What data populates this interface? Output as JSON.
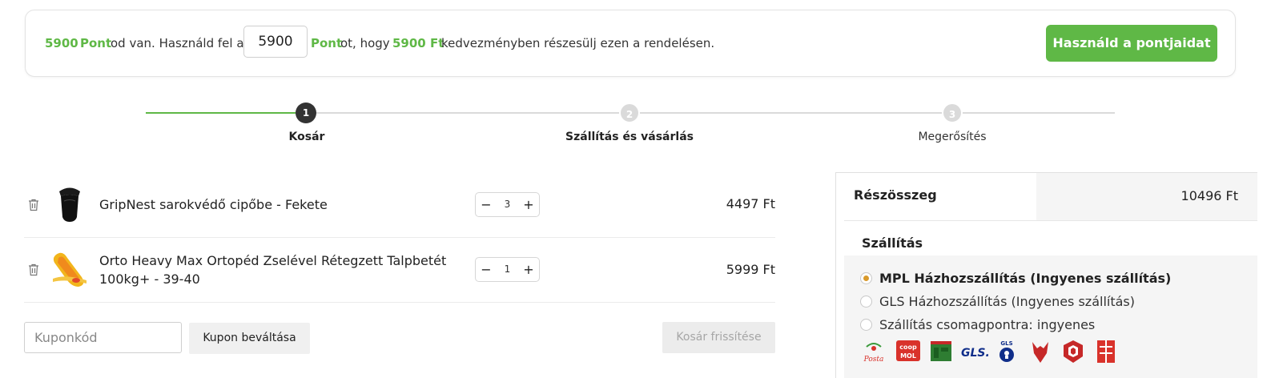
{
  "points_banner": {
    "points_amount": "5900",
    "points_word": "Pont",
    "text_have": "od van. Használd fel a",
    "input_value": "5900",
    "points_word_2": "Pont",
    "text_so": "ot, hogy",
    "discount": "5900 Ft",
    "text_rest": "kedvezményben részesülj ezen a rendelésen.",
    "button_label": "Használd a pontjaidat"
  },
  "stepper": {
    "steps": [
      {
        "number": "1",
        "label": "Kosár",
        "active": true
      },
      {
        "number": "2",
        "label": "Szállítás és vásárlás",
        "active": false
      },
      {
        "number": "3",
        "label": "Megerősítés",
        "active": false
      }
    ],
    "colors": {
      "active": "#333333",
      "inactive": "#dadada",
      "progress": "#5fb846"
    }
  },
  "cart": {
    "items": [
      {
        "name_line1": "GripNest sarokvédő cipőbe - Fekete",
        "name_line2": "",
        "quantity": "3",
        "price": "4497 Ft",
        "icon": "shoe-heel-insert-image"
      },
      {
        "name_line1": "Orto Heavy Max Ortopéd Zselével Rétegzett Talpbetét",
        "name_line2": "100kg+ - 39-40",
        "quantity": "1",
        "price": "5999 Ft",
        "icon": "insole-image"
      }
    ],
    "qty_minus": "−",
    "qty_plus": "+",
    "coupon_placeholder": "Kuponkód",
    "coupon_button": "Kupon beváltása",
    "update_button": "Kosár frissítése"
  },
  "summary": {
    "subtotal_label": "Részösszeg",
    "subtotal_value": "10496 Ft",
    "shipping_title": "Szállítás",
    "options": [
      {
        "label": "MPL Házhozszállítás (Ingyenes szállítás)",
        "selected": true
      },
      {
        "label": "GLS Házhozszállítás (Ingyenes szállítás)",
        "selected": false
      },
      {
        "label": "Szállítás csomagpontra: ingyenes",
        "selected": false
      }
    ],
    "carrier_logos": [
      {
        "icon": "posta-logo",
        "text": "Posta"
      },
      {
        "icon": "coop-logo",
        "text_top": "coop",
        "text_bottom": "MOL"
      },
      {
        "icon": "parcel-locker-logo"
      },
      {
        "icon": "gls-logo",
        "text": "GLS."
      },
      {
        "icon": "gls-pin-logo",
        "text": "GLS"
      },
      {
        "icon": "fox-logo"
      },
      {
        "icon": "box-logo"
      },
      {
        "icon": "packeta-logo"
      }
    ]
  },
  "colors": {
    "accent_green": "#5fb846",
    "radio_selected": "#d99a2b"
  }
}
